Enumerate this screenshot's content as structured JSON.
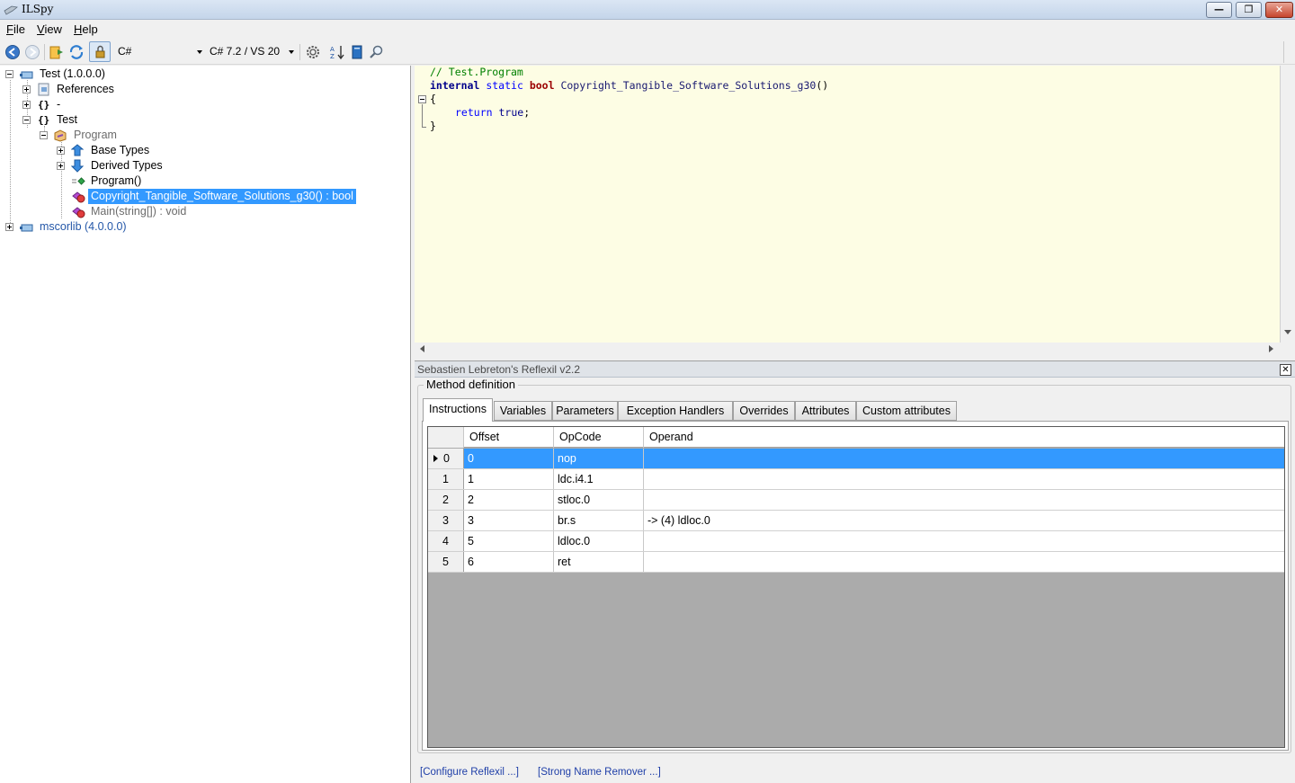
{
  "window": {
    "title": "ILSpy"
  },
  "menu": {
    "file": "File",
    "view": "View",
    "help": "Help",
    "file_ul": "F",
    "file_rest": "ile",
    "view_ul": "V",
    "view_rest": "iew",
    "help_ul": "H",
    "help_rest": "elp"
  },
  "toolbar": {
    "language": "C#",
    "version": "C# 7.2 / VS 20"
  },
  "tree": {
    "test_assembly": "Test (1.0.0.0)",
    "references": "References",
    "ns_empty": "-",
    "ns_test": "Test",
    "program_class": "Program",
    "base_types": "Base Types",
    "derived_types": "Derived Types",
    "ctor": "Program()",
    "selected_method": "Copyright_Tangible_Software_Solutions_g30() : bool",
    "main_method": "Main(string[]) : void",
    "mscorlib": "mscorlib (4.0.0.0)"
  },
  "code": {
    "comment": "// Test.Program",
    "kw_internal": "internal",
    "kw_static": "static",
    "kw_bool": "bool",
    "method_sig": "Copyright_Tangible_Software_Solutions_g30",
    "parens": "()",
    "open_brace": "{",
    "kw_return": "return",
    "kw_true": "true",
    "semicolon": ";",
    "close_brace": "}"
  },
  "reflexil": {
    "title": "Sebastien Lebreton's Reflexil v2.2",
    "group": "Method definition",
    "tabs": [
      "Instructions",
      "Variables",
      "Parameters",
      "Exception Handlers",
      "Overrides",
      "Attributes",
      "Custom attributes"
    ],
    "columns": [
      "Offset",
      "OpCode",
      "Operand"
    ],
    "rows": [
      {
        "index": "0",
        "offset": "0",
        "opcode": "nop",
        "operand": ""
      },
      {
        "index": "1",
        "offset": "1",
        "opcode": "ldc.i4.1",
        "operand": ""
      },
      {
        "index": "2",
        "offset": "2",
        "opcode": "stloc.0",
        "operand": ""
      },
      {
        "index": "3",
        "offset": "3",
        "opcode": "br.s",
        "operand": "-> (4) ldloc.0"
      },
      {
        "index": "4",
        "offset": "5",
        "opcode": "ldloc.0",
        "operand": ""
      },
      {
        "index": "5",
        "offset": "6",
        "opcode": "ret",
        "operand": ""
      }
    ],
    "configure_link": "[Configure Reflexil ...]",
    "strong_name_link": "[Strong Name Remover ...]"
  },
  "colors": {
    "selection": "#3399ff",
    "editor_bg": "#fdfde4",
    "grid_empty": "#ababab"
  }
}
